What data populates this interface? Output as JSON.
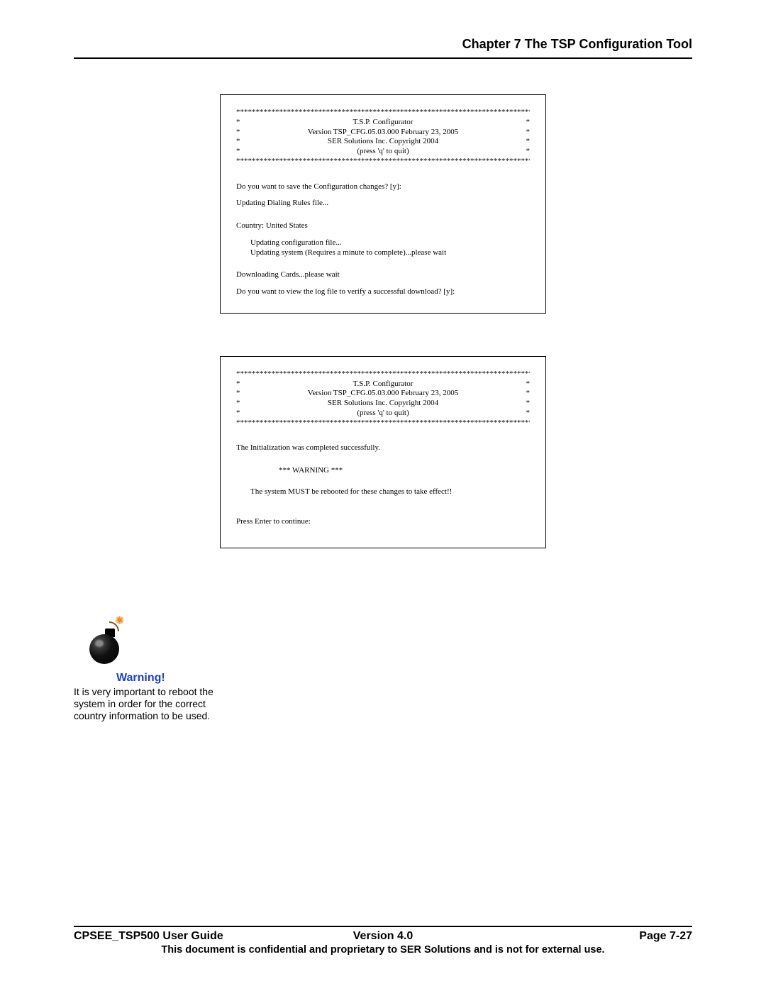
{
  "header": {
    "chapter": "Chapter 7 The TSP Configuration Tool"
  },
  "terminal1": {
    "stars_top": "*****************************************************************************",
    "banner": {
      "l1": {
        "left": "*",
        "center": "T.S.P. Configurator",
        "right": "*"
      },
      "l2": {
        "left": "*",
        "center": "Version TSP_CFG.05.03.000    February 23, 2005",
        "right": "*"
      },
      "l3": {
        "left": "*",
        "center": "SER Solutions Inc. Copyright 2004",
        "right": "*"
      },
      "l4": {
        "left": "*",
        "center": "(press 'q' to quit)",
        "right": "*"
      }
    },
    "stars_bot": "*****************************************************************************",
    "q_save": "Do you want to save the Configuration changes? [y]:",
    "upd_rules": "Updating Dialing Rules file...",
    "country": "Country:  United States",
    "upd_cfg": "Updating configuration file...",
    "upd_sys": "Updating system (Requires a minute to complete)...please wait",
    "dl_cards": "Downloading Cards...please wait",
    "q_log": "Do you want to view the log file to verify a successful download? [y]:"
  },
  "terminal2": {
    "stars_top": "*****************************************************************************",
    "banner": {
      "l1": {
        "left": "*",
        "center": "T.S.P. Configurator",
        "right": "*"
      },
      "l2": {
        "left": "*",
        "center": "Version TSP_CFG.05.03.000    February 23, 2005",
        "right": "*"
      },
      "l3": {
        "left": "*",
        "center": "SER Solutions Inc. Copyright 2004",
        "right": "*"
      },
      "l4": {
        "left": "*",
        "center": "(press 'q' to quit)",
        "right": "*"
      }
    },
    "stars_bot": "*****************************************************************************",
    "init_ok": "The Initialization was completed successfully.",
    "warn": "*** WARNING ***",
    "reboot": "The system MUST be rebooted for these changes to take effect!!",
    "press": "Press Enter to continue:"
  },
  "warning": {
    "label": "Warning!",
    "text": " It is very important to reboot the system in order for the correct country information to be used."
  },
  "footer": {
    "left": "CPSEE_TSP500 User Guide",
    "center": "Version 4.0",
    "right": "Page 7-27",
    "note": "This document is confidential and proprietary to SER Solutions and is not for external use."
  }
}
